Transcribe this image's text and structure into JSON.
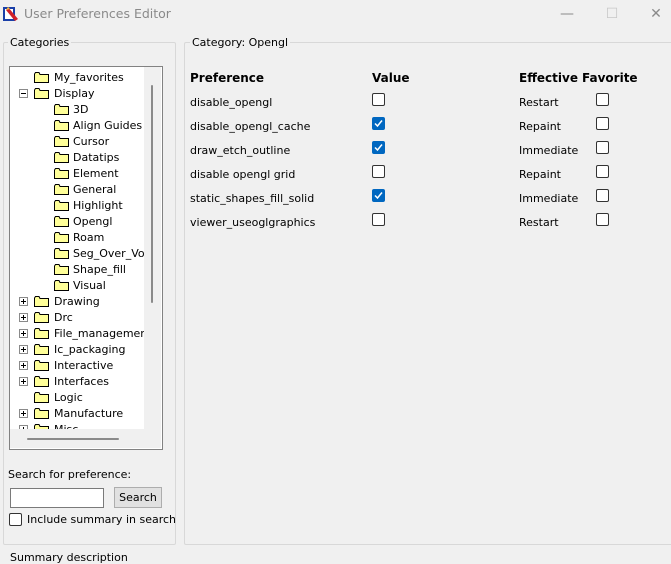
{
  "window": {
    "title": "User Preferences Editor",
    "minimize_glyph": "—",
    "maximize_glyph": "☐",
    "close_glyph": "✕"
  },
  "categories_group": {
    "label": "Categories"
  },
  "tree": {
    "items": [
      {
        "label": "My_favorites",
        "expander": "none",
        "level": 0
      },
      {
        "label": "Display",
        "expander": "minus",
        "level": 0
      },
      {
        "label": "3D",
        "expander": "none",
        "level": 1
      },
      {
        "label": "Align Guides",
        "expander": "none",
        "level": 1
      },
      {
        "label": "Cursor",
        "expander": "none",
        "level": 1
      },
      {
        "label": "Datatips",
        "expander": "none",
        "level": 1
      },
      {
        "label": "Element",
        "expander": "none",
        "level": 1
      },
      {
        "label": "General",
        "expander": "none",
        "level": 1
      },
      {
        "label": "Highlight",
        "expander": "none",
        "level": 1
      },
      {
        "label": "Opengl",
        "expander": "none",
        "level": 1
      },
      {
        "label": "Roam",
        "expander": "none",
        "level": 1
      },
      {
        "label": "Seg_Over_Voi",
        "expander": "none",
        "level": 1
      },
      {
        "label": "Shape_fill",
        "expander": "none",
        "level": 1
      },
      {
        "label": "Visual",
        "expander": "none",
        "level": 1
      },
      {
        "label": "Drawing",
        "expander": "plus",
        "level": 0
      },
      {
        "label": "Drc",
        "expander": "plus",
        "level": 0
      },
      {
        "label": "File_management",
        "expander": "plus",
        "level": 0
      },
      {
        "label": "Ic_packaging",
        "expander": "plus",
        "level": 0
      },
      {
        "label": "Interactive",
        "expander": "plus",
        "level": 0
      },
      {
        "label": "Interfaces",
        "expander": "plus",
        "level": 0
      },
      {
        "label": "Logic",
        "expander": "none",
        "level": 0
      },
      {
        "label": "Manufacture",
        "expander": "plus",
        "level": 0
      },
      {
        "label": "Misc",
        "expander": "plus",
        "level": 0
      }
    ]
  },
  "search": {
    "label": "Search for preference:",
    "value": "",
    "button_label": "Search",
    "include_summary_label": "Include summary in search",
    "include_summary_checked": false
  },
  "category_group": {
    "label": "Category:   Opengl"
  },
  "table": {
    "headers": [
      "Preference",
      "Value",
      "Effective",
      "Favorite"
    ],
    "rows": [
      {
        "name": "disable_opengl",
        "value": false,
        "effective": "Restart",
        "favorite": false
      },
      {
        "name": "disable_opengl_cache",
        "value": true,
        "effective": "Repaint",
        "favorite": false
      },
      {
        "name": "draw_etch_outline",
        "value": true,
        "effective": "Immediate",
        "favorite": false
      },
      {
        "name": "disable opengl grid",
        "value": false,
        "effective": "Repaint",
        "favorite": false
      },
      {
        "name": "static_shapes_fill_solid",
        "value": true,
        "effective": "Immediate",
        "favorite": false
      },
      {
        "name": "viewer_useoglgraphics",
        "value": false,
        "effective": "Restart",
        "favorite": false
      }
    ]
  },
  "summary": {
    "label": "Summary description"
  },
  "colors": {
    "checkbox_checked": "#0067c0",
    "folder_fill": "#ffff99",
    "folder_stroke": "#000000",
    "title_text": "#8a8a8a"
  }
}
